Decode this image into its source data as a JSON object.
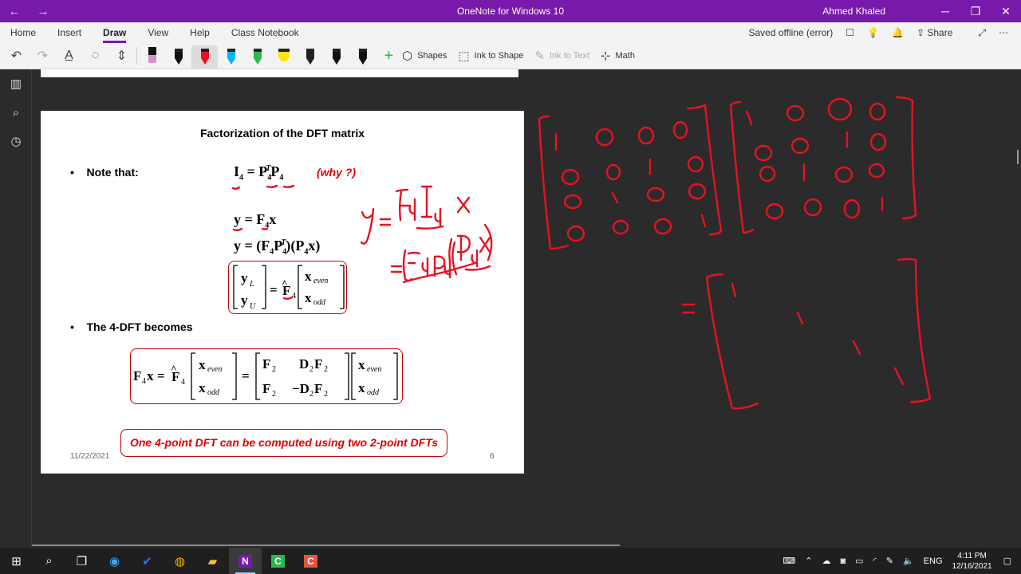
{
  "window": {
    "title": "OneNote for Windows 10",
    "user": "Ahmed Khaled"
  },
  "tabs": [
    "Home",
    "Insert",
    "Draw",
    "View",
    "Help",
    "Class Notebook"
  ],
  "active_tab": "Draw",
  "status": {
    "saved": "Saved offline (error)",
    "share": "Share"
  },
  "toolbar": {
    "shapes": "Shapes",
    "ink_to_shape": "Ink to Shape",
    "ink_to_text": "Ink to Text",
    "math": "Math"
  },
  "pens": [
    {
      "name": "black-pen",
      "color": "#111111"
    },
    {
      "name": "red-pen",
      "color": "#e81123"
    },
    {
      "name": "cyan-pen",
      "color": "#00b7f1"
    },
    {
      "name": "green-pen",
      "color": "#2db84d"
    },
    {
      "name": "yellow-highlighter",
      "color": "#ffe600"
    },
    {
      "name": "black-pen-2",
      "color": "#222222"
    },
    {
      "name": "black-pen-3",
      "color": "#111111"
    },
    {
      "name": "black-pen-4",
      "color": "#111111"
    }
  ],
  "slide": {
    "title": "Factorization of the DFT matrix",
    "bullet1": "Note that:",
    "why": "(why ?)",
    "bullet2": "The 4-DFT becomes",
    "conclusion": "One 4-point DFT can be computed using two 2-point DFTs",
    "date": "11/22/2021",
    "page": "6"
  },
  "colors": {
    "accent": "#7719aa",
    "ink": "#e81123"
  },
  "taskbar": {
    "lang": "ENG",
    "time": "4:11 PM",
    "date": "12/16/2021"
  }
}
